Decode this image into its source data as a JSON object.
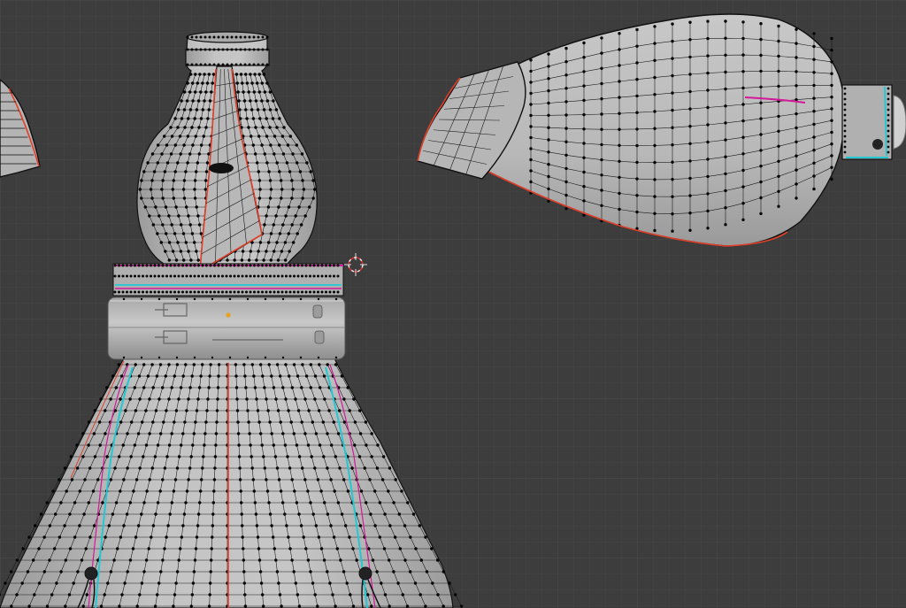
{
  "viewport": {
    "background_color": "#3d3d3d",
    "grid_minor_color": "#454545",
    "grid_major_color": "#4d4d4d",
    "grid": true
  },
  "mesh": {
    "surface_color": "#bcbcbc",
    "wire_color": "#111111",
    "vertex_color": "#050505",
    "seam_color": "#e0402a",
    "sharp_color": "#22c8d4",
    "crease_color": "#d4189a"
  },
  "objects": [
    {
      "name": "dress-mesh-front-view"
    },
    {
      "name": "sleeve-mesh-side-view"
    },
    {
      "name": "waist-belt-mesh"
    },
    {
      "name": "tie-mesh"
    },
    {
      "name": "partial-sleeve-left-edge"
    }
  ],
  "cursor": {
    "icon": "3d-cursor-icon"
  },
  "origin_marker": {
    "icon": "object-origin-dot",
    "color": "#e8a020"
  }
}
